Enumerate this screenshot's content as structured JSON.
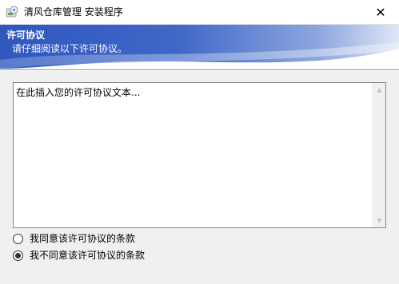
{
  "window": {
    "title": "清风仓库管理 安装程序",
    "close_glyph": "✕"
  },
  "header": {
    "title": "许可协议",
    "subtitle": "请仔细阅读以下许可协议。"
  },
  "license": {
    "text": "在此插入您的许可协议文本..."
  },
  "options": [
    {
      "label": "我同意该许可协议的条款",
      "checked": false
    },
    {
      "label": "我不同意该许可协议的条款",
      "checked": true
    }
  ],
  "colors": {
    "header_blue": "#3a63c4",
    "header_light": "#eef2fb"
  }
}
